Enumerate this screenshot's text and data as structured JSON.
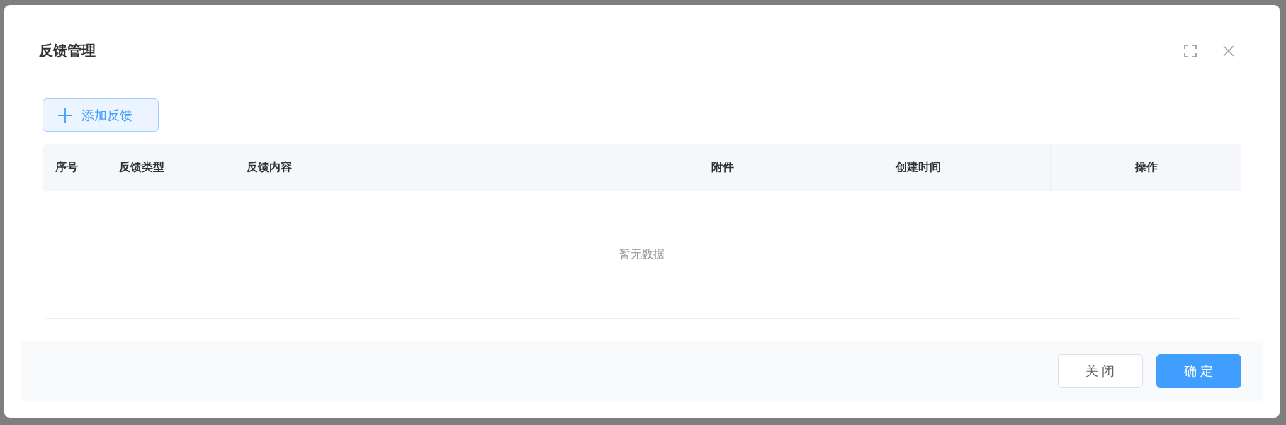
{
  "dialog": {
    "title": "反馈管理"
  },
  "toolbar": {
    "add_button": {
      "label": "添加反馈"
    }
  },
  "table": {
    "columns": [
      {
        "label": "序号"
      },
      {
        "label": "反馈类型"
      },
      {
        "label": "反馈内容"
      },
      {
        "label": "附件"
      },
      {
        "label": "创建时间"
      },
      {
        "label": "操作"
      }
    ],
    "empty_text": "暂无数据"
  },
  "footer": {
    "buttons": [
      {
        "label": "关 闭",
        "kind": "secondary"
      },
      {
        "label": "确 定",
        "kind": "primary"
      }
    ]
  }
}
